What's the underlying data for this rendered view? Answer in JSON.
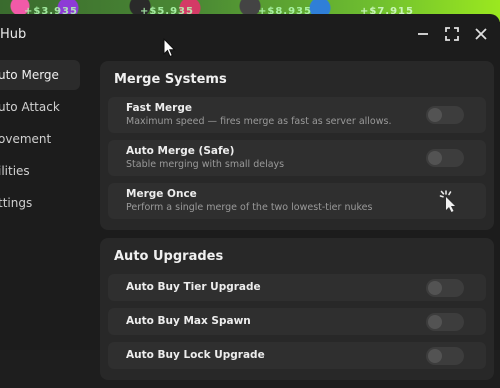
{
  "scene": {
    "money": [
      "+$3.935",
      "+$5.935",
      "+$8.935",
      "+$7.915"
    ]
  },
  "window": {
    "title": "Hub",
    "controls": {
      "minimize": "minimize-icon",
      "maximize": "maximize-icon",
      "close": "close-icon"
    }
  },
  "sidebar": {
    "items": [
      {
        "label": "uto Merge",
        "active": true
      },
      {
        "label": "uto Attack",
        "active": false
      },
      {
        "label": "ovement",
        "active": false
      },
      {
        "label": "ilities",
        "active": false
      },
      {
        "label": "ttings",
        "active": false
      }
    ]
  },
  "sections": {
    "merge": {
      "title": "Merge Systems",
      "rows": [
        {
          "label": "Fast Merge",
          "desc": "Maximum speed — fires merge as fast as server allows.",
          "control": "toggle",
          "on": false
        },
        {
          "label": "Auto Merge (Safe)",
          "desc": "Stable merging with small delays",
          "control": "toggle",
          "on": false
        },
        {
          "label": "Merge Once",
          "desc": "Perform a single merge of the two lowest-tier nukes",
          "control": "click-icon"
        }
      ]
    },
    "upgrades": {
      "title": "Auto Upgrades",
      "rows": [
        {
          "label": "Auto Buy Tier Upgrade",
          "control": "toggle",
          "on": false
        },
        {
          "label": "Auto Buy Max Spawn",
          "control": "toggle",
          "on": false
        },
        {
          "label": "Auto Buy Lock Upgrade",
          "control": "toggle",
          "on": false
        }
      ]
    }
  },
  "colors": {
    "window_bg": "#1c1c1c",
    "section_bg": "#282828",
    "row_bg": "#2f2f2f",
    "toggle_off": "#3d3d3d"
  }
}
